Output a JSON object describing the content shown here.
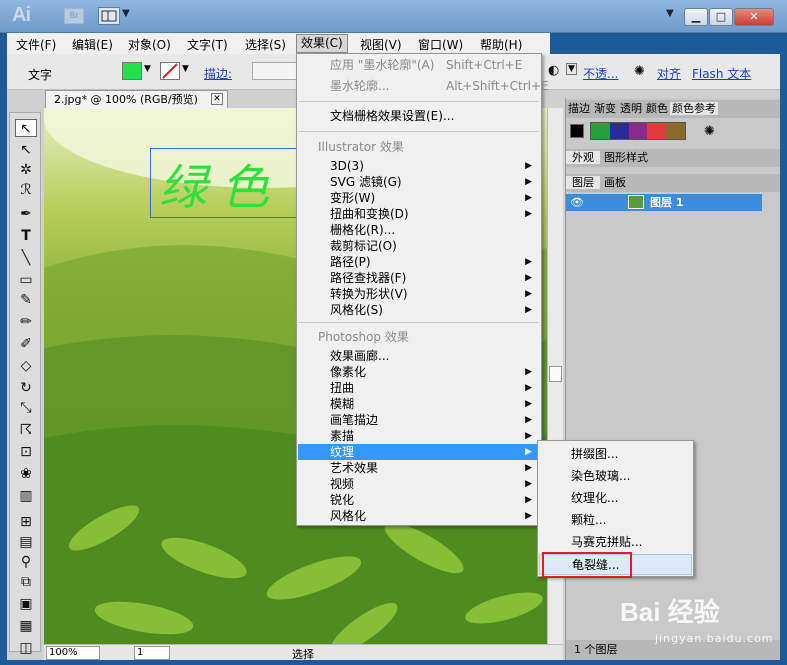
{
  "window": {
    "app_logo": "Ai",
    "bridge": "Br",
    "dropdown_glyph": "▼",
    "min": "▁",
    "max": "□",
    "close": "✕",
    "close_color": "#c8403a"
  },
  "menubar": [
    "文件(F)",
    "编辑(E)",
    "对象(O)",
    "文字(T)",
    "选择(S)",
    "效果(C)",
    "视图(V)",
    "窗口(W)",
    "帮助(H)"
  ],
  "control": {
    "type_label": "文字",
    "fill_color": "#22e04a",
    "stroke_label": "描边:",
    "opacity_label": "不透...",
    "align_label": "对齐",
    "flash_label": "Flash 文本"
  },
  "doc": {
    "tab_title": "2.jpg* @ 100% (RGB/预览)",
    "text_art": "绿色",
    "text_color": "#2ee03a"
  },
  "effect_menu": {
    "apply_last": "应用 \"墨水轮廓\"(A)",
    "apply_last_shortcut": "Shift+Ctrl+E",
    "last_effect": "墨水轮廓...",
    "last_effect_shortcut": "Alt+Shift+Ctrl+E",
    "raster_settings": "文档栅格效果设置(E)...",
    "illustrator_header": "Illustrator 效果",
    "illustrator_items": [
      "3D(3)",
      "SVG 滤镜(G)",
      "变形(W)",
      "扭曲和变换(D)",
      "栅格化(R)...",
      "裁剪标记(O)",
      "路径(P)",
      "路径查找器(F)",
      "转换为形状(V)",
      "风格化(S)"
    ],
    "photoshop_header": "Photoshop 效果",
    "photoshop_items": [
      "效果画廊...",
      "像素化",
      "扭曲",
      "模糊",
      "画笔描边",
      "素描",
      "纹理",
      "艺术效果",
      "视频",
      "锐化",
      "风格化"
    ]
  },
  "submenu": [
    "拼缀图...",
    "染色玻璃...",
    "纹理化...",
    "颗粒...",
    "马赛克拼贴...",
    "龟裂缝..."
  ],
  "panel": {
    "tabs_top": [
      "描边",
      "渐变",
      "透明",
      "颜色",
      "颜色参考"
    ],
    "swatches": [
      "#000000",
      "#22a03a",
      "#2a2a9a",
      "#8a2a8a",
      "#e03a3a",
      "#8a6a2a"
    ],
    "tabs_mid": [
      "外观",
      "图形样式"
    ],
    "tabs_layer": [
      "图层",
      "画板"
    ],
    "layer_name": "图层 1",
    "layer_count": "1 个图层"
  },
  "status": {
    "zoom": "100%",
    "page": "1",
    "select_label": "选择"
  },
  "watermark": {
    "logo": "Bai 经验",
    "url": "jingyan.baidu.com"
  }
}
